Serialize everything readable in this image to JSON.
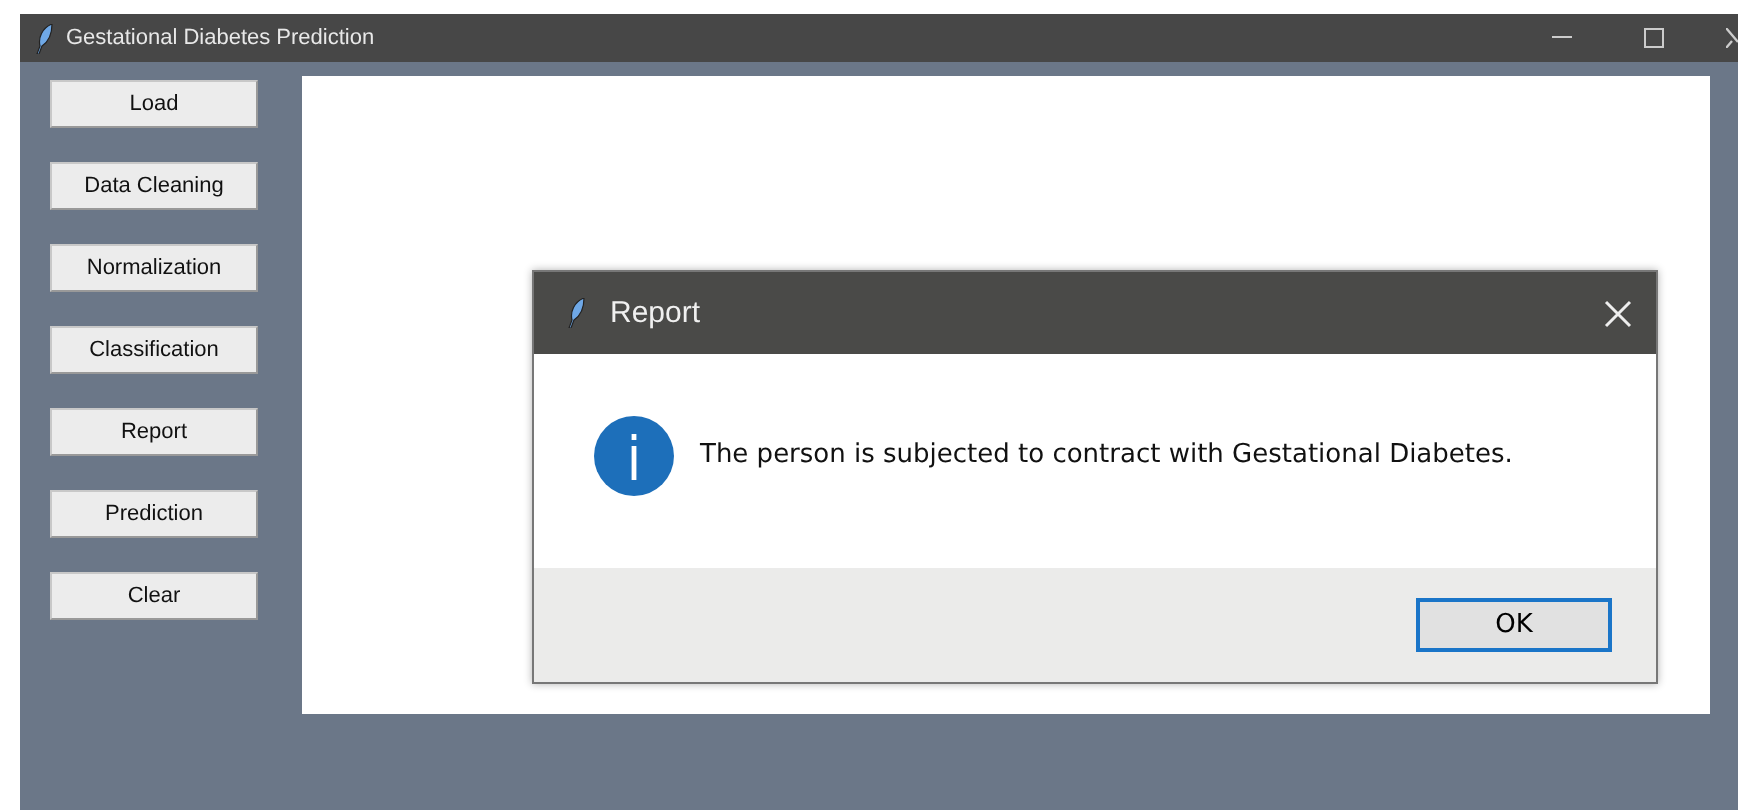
{
  "window": {
    "title": "Gestational Diabetes Prediction"
  },
  "sidebar": {
    "buttons": [
      "Load",
      "Data Cleaning",
      "Normalization",
      "Classification",
      "Report",
      "Prediction",
      "Clear"
    ]
  },
  "dialog": {
    "title": "Report",
    "message": "The person is subjected to contract with Gestational Diabetes.",
    "buttons": [
      {
        "label": "OK",
        "selected": true
      }
    ]
  }
}
